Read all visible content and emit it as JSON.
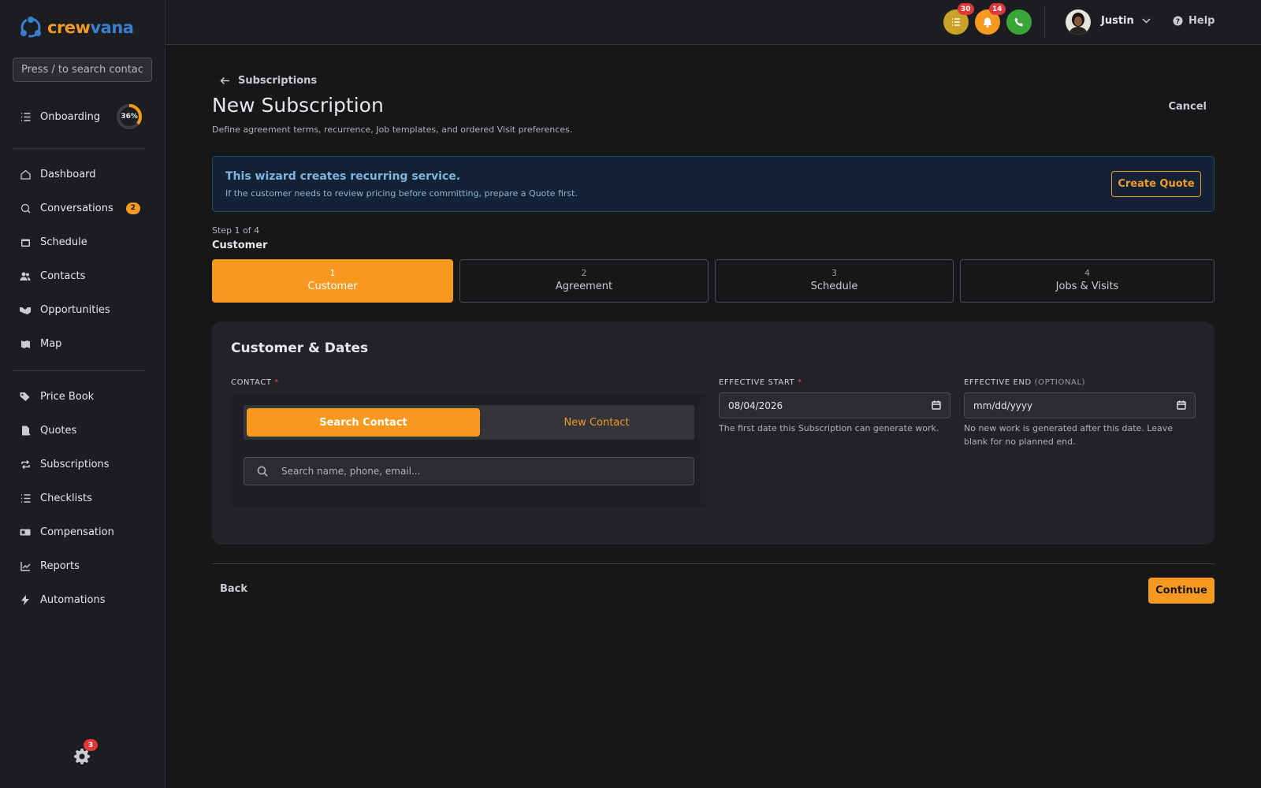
{
  "brand": {
    "name_part1": "crew",
    "name_part2": "vana"
  },
  "sidebar": {
    "search_placeholder": "Press / to search contacts",
    "onboarding": {
      "label": "Onboarding",
      "progress_percent": 36,
      "progress_text": "36%"
    },
    "items": [
      {
        "label": "Dashboard",
        "icon": "home-icon"
      },
      {
        "label": "Conversations",
        "icon": "chat-icon",
        "badge": "2"
      },
      {
        "label": "Schedule",
        "icon": "calendar-icon"
      },
      {
        "label": "Contacts",
        "icon": "users-icon"
      },
      {
        "label": "Opportunities",
        "icon": "handshake-icon"
      },
      {
        "label": "Map",
        "icon": "map-icon"
      },
      {
        "label": "Price Book",
        "icon": "tags-icon"
      },
      {
        "label": "Quotes",
        "icon": "quote-icon"
      },
      {
        "label": "Subscriptions",
        "icon": "repeat-icon"
      },
      {
        "label": "Checklists",
        "icon": "checklist-icon"
      },
      {
        "label": "Compensation",
        "icon": "money-icon"
      },
      {
        "label": "Reports",
        "icon": "chart-icon"
      },
      {
        "label": "Automations",
        "icon": "bolt-icon"
      }
    ],
    "settings_badge": "3"
  },
  "topbar": {
    "tasks_badge": "30",
    "notifications_badge": "14",
    "user_name": "Justin",
    "help_label": "Help"
  },
  "page": {
    "back_label": "Subscriptions",
    "title": "New Subscription",
    "subtitle": "Define agreement terms, recurrence, Job templates, and ordered Visit preferences.",
    "cancel_label": "Cancel"
  },
  "banner": {
    "title": "This wizard creates recurring service.",
    "text": "If the customer needs to review pricing before committing, prepare a Quote first.",
    "button_label": "Create Quote"
  },
  "wizard": {
    "step_indicator": "Step 1 of 4",
    "current_step_title": "Customer",
    "steps": [
      {
        "num": "1",
        "label": "Customer"
      },
      {
        "num": "2",
        "label": "Agreement"
      },
      {
        "num": "3",
        "label": "Schedule"
      },
      {
        "num": "4",
        "label": "Jobs & Visits"
      }
    ]
  },
  "form": {
    "section_title": "Customer & Dates",
    "contact_label": "Contact",
    "required_mark": "*",
    "search_contact_label": "Search Contact",
    "new_contact_label": "New Contact",
    "contact_search_placeholder": "Search name, phone, email...",
    "effective_start_label": "Effective Start",
    "effective_start_value": "08/04/2026",
    "effective_start_help": "The first date this Subscription can generate work.",
    "effective_end_label": "Effective End",
    "effective_end_optional": "(Optional)",
    "effective_end_placeholder": "mm/dd/yyyy",
    "effective_end_help": "No new work is generated after this date. Leave blank for no planned end."
  },
  "footer": {
    "back_label": "Back",
    "continue_label": "Continue"
  },
  "colors": {
    "accent": "#f7991e",
    "brand_blue": "#3b7fd0",
    "danger": "#e03838",
    "success": "#3aa63a",
    "gold": "#c9a227"
  }
}
